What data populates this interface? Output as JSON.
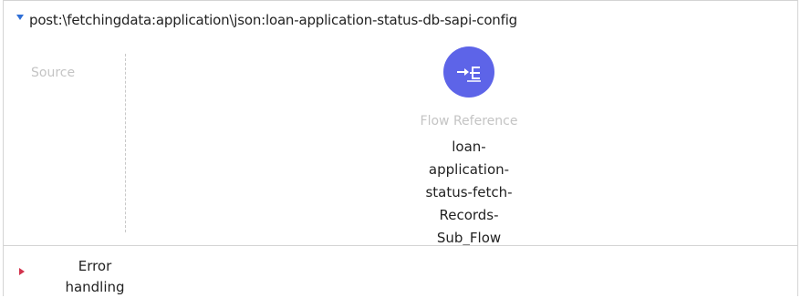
{
  "flow": {
    "title": "post:\\fetchingdata:application\\json:loan-application-status-db-sapi-config",
    "source_label": "Source",
    "component": {
      "icon": "flow-reference-icon",
      "icon_color": "#5d64e8",
      "type_label": "Flow Reference",
      "name_lines": [
        "loan-",
        "application-",
        "status-fetch-",
        "Records-",
        "Sub_Flow"
      ]
    },
    "error_handling": {
      "lines": [
        "Error",
        "handling"
      ],
      "arrow_color": "#d2324c"
    },
    "collapse_arrow_color": "#2f6fd6"
  }
}
